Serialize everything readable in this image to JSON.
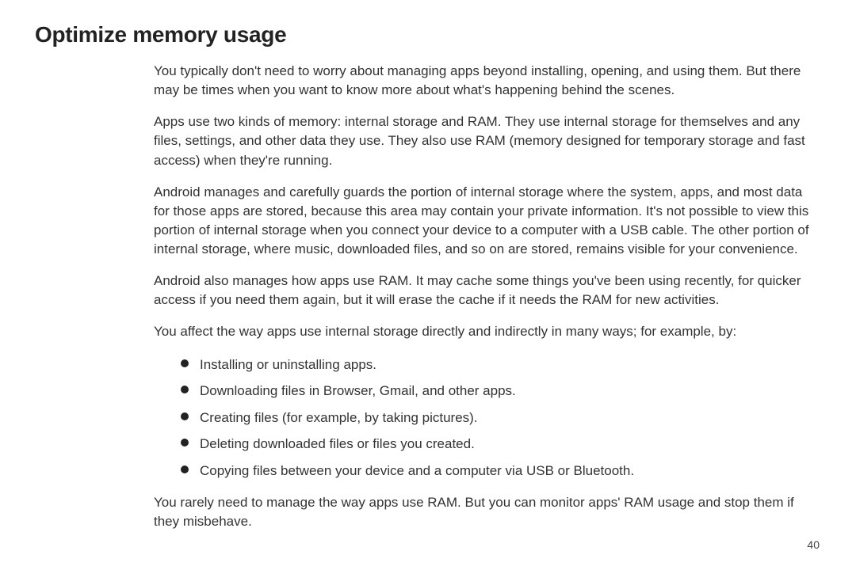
{
  "heading": "Optimize memory usage",
  "p1": "You typically don't need to worry about managing apps beyond installing, opening, and using them. But there may be times when you want to know more about what's happening behind the scenes.",
  "p2": "Apps use two kinds of memory: internal storage and RAM. They use internal storage for themselves and any files, settings, and other data they use. They also use RAM (memory designed for temporary storage and fast access) when they're running.",
  "p3": "Android manages and carefully guards the portion of internal storage where the system, apps, and most data for those apps are stored, because this area may contain your private information. It's not possible to view this portion of internal storage when you connect your device to a computer with a USB cable. The other portion of internal storage, where music, downloaded files, and so on are stored, remains visible for your convenience.",
  "p4": "Android also manages how apps use RAM. It may cache some things you've been using recently, for quicker access if you need them again, but it will erase the cache if it needs the RAM for new activities.",
  "p5": "You affect the way apps use internal storage directly and indirectly in many ways; for example, by:",
  "bullets": [
    "Installing or uninstalling apps.",
    "Downloading files in Browser, Gmail, and other apps.",
    "Creating files (for example, by taking pictures).",
    "Deleting downloaded files or files you created.",
    "Copying files between your device and a computer via USB or Bluetooth."
  ],
  "p6": "You rarely need to manage the way apps use RAM. But you can monitor apps' RAM usage and stop them if they misbehave.",
  "page_number": "40"
}
